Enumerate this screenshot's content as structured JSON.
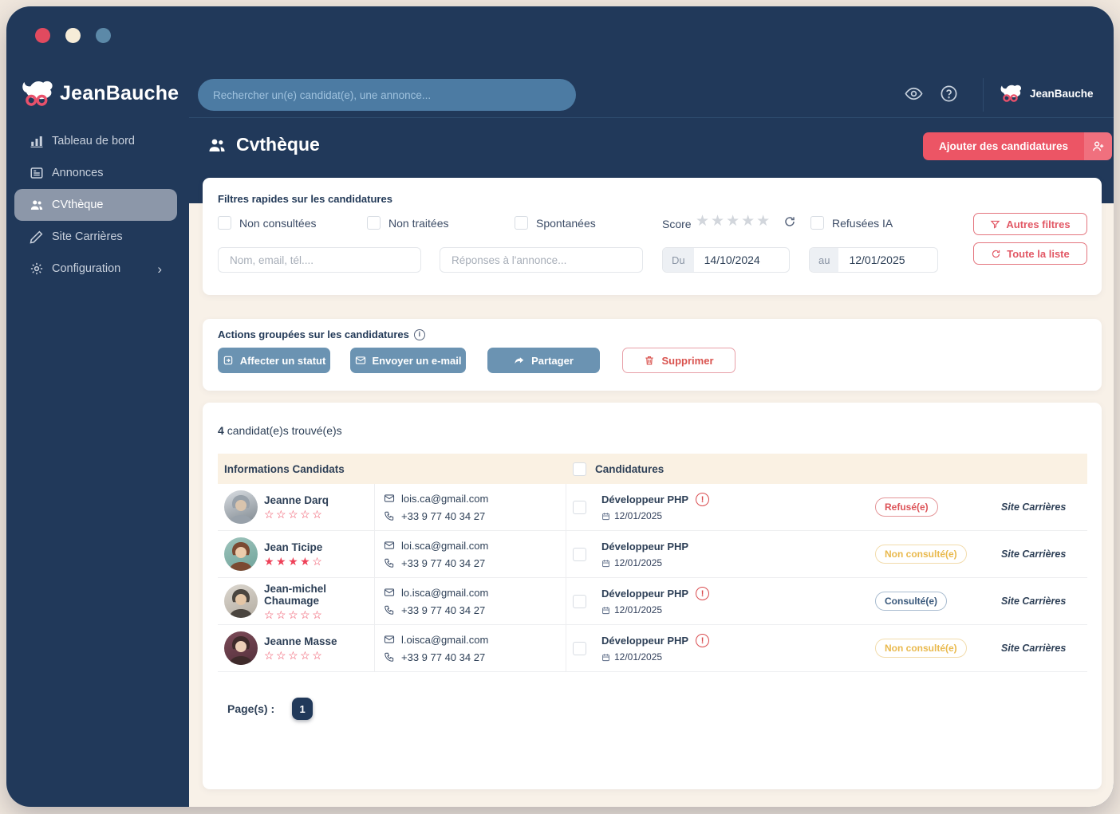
{
  "window_controls": {
    "colors": [
      "#E14A5F",
      "#F6ECD8",
      "#5C89A8"
    ]
  },
  "sidebar": {
    "brand_name": "JeanBauche",
    "items": [
      {
        "label": "Tableau de bord"
      },
      {
        "label": "Annonces"
      },
      {
        "label": "CVthèque"
      },
      {
        "label": "Site Carrières"
      },
      {
        "label": "Configuration"
      }
    ],
    "configuration_chevron": "›"
  },
  "topbar": {
    "search_placeholder": "Rechercher un(e) candidat(e), une annonce...",
    "account_name": "JeanBauche"
  },
  "page": {
    "title": "Cvthèque",
    "add_button_label": "Ajouter des candidatures"
  },
  "filters": {
    "title": "Filtres rapides sur les candidatures",
    "quick": [
      "Non consultées",
      "Non traitées",
      "Spontanées"
    ],
    "score_label": "Score",
    "refused_ai_label": "Refusées IA",
    "name_placeholder": "Nom, email, tél....",
    "annonce_placeholder": "Réponses à l'annonce...",
    "date_from_label": "Du",
    "date_from_value": "14/10/2024",
    "date_to_label": "au",
    "date_to_value": "12/01/2025",
    "more_filters_label": "Autres filtres",
    "full_list_label": "Toute la liste"
  },
  "bulk_actions": {
    "title": "Actions groupées sur les candidatures",
    "assign_status_label": "Affecter un statut",
    "send_email_label": "Envoyer un e-mail",
    "share_label": "Partager",
    "delete_label": "Supprimer"
  },
  "results": {
    "count": "4",
    "count_label": "candidat(e)s trouvé(e)s",
    "columns": {
      "candidates": "Informations Candidats",
      "applications": "Candidatures"
    },
    "rows": [
      {
        "name": "Jeanne Darq",
        "stars": 0,
        "avatar": "av1",
        "email": "lois.ca@gmail.com",
        "phone": "+33 9 77 40 34 27",
        "job": "Développeur PHP",
        "warning": true,
        "date": "12/01/2025",
        "status": "Refusé(e)",
        "status_type": "refused",
        "source": "Site Carrières"
      },
      {
        "name": "Jean Ticipe",
        "stars": 4,
        "avatar": "av2",
        "email": "loi.sca@gmail.com",
        "phone": "+33 9 77 40 34 27",
        "job": "Développeur PHP",
        "warning": false,
        "date": "12/01/2025",
        "status": "Non consulté(e)",
        "status_type": "pending",
        "source": "Site Carrières"
      },
      {
        "name": "Jean-michel Chaumage",
        "stars": 0,
        "avatar": "av3",
        "email": "lo.isca@gmail.com",
        "phone": "+33 9 77 40 34 27",
        "job": "Développeur PHP",
        "warning": true,
        "date": "12/01/2025",
        "status": "Consulté(e)",
        "status_type": "viewed",
        "source": "Site Carrières"
      },
      {
        "name": "Jeanne Masse",
        "stars": 0,
        "avatar": "av4",
        "email": "l.oisca@gmail.com",
        "phone": "+33 9 77 40 34 27",
        "job": "Développeur PHP",
        "warning": true,
        "date": "12/01/2025",
        "status": "Non consulté(e)",
        "status_type": "pending",
        "source": "Site Carrières"
      }
    ]
  },
  "pagination": {
    "label": "Page(s) :",
    "pages": [
      "1"
    ]
  },
  "colors": {
    "navy": "#21395A",
    "accent_red": "#EC5565",
    "steel_blue": "#6B93B2",
    "cream": "#F8F1E8",
    "table_header_cream": "#FAF1E3",
    "badge_refused": "#DD5459",
    "badge_pending": "#E9B94D",
    "badge_viewed": "#39587B"
  }
}
